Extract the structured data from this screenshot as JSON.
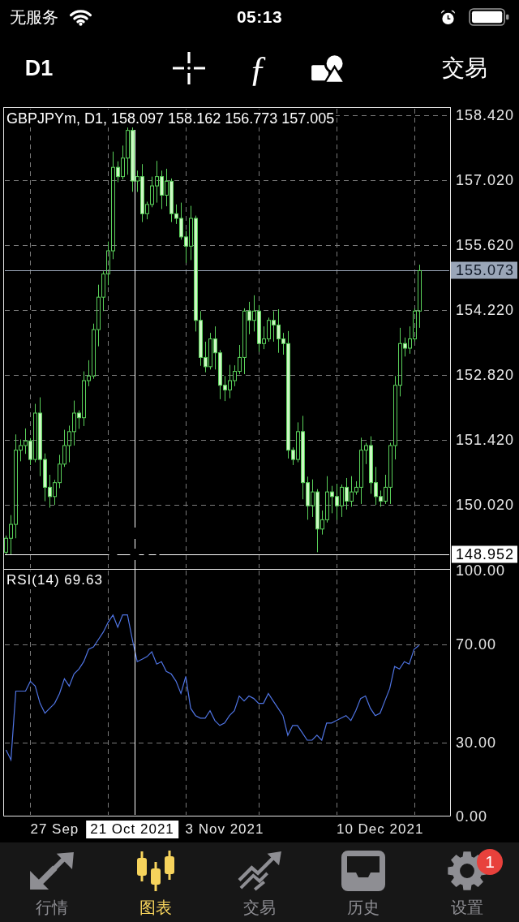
{
  "status_bar": {
    "carrier": "无服务",
    "time": "05:13"
  },
  "toolbar": {
    "timeframe": "D1",
    "indicator_glyph": "ƒ",
    "trade_button": "交易"
  },
  "price_chart": {
    "chart_data": {
      "type": "candlestick",
      "title": "GBPJPYm, D1, 158.097 158.162 156.773 157.005",
      "categories": [
        null,
        null,
        null,
        null,
        null,
        null,
        null,
        null,
        null,
        null,
        null,
        null,
        null,
        null,
        null,
        null,
        null,
        null,
        null,
        null,
        null,
        null,
        null,
        null,
        null,
        null,
        null,
        null,
        null,
        null,
        null,
        null,
        null,
        null,
        null,
        null,
        null,
        null,
        null,
        null,
        null,
        null,
        null,
        null,
        null,
        null,
        null,
        null,
        null,
        null,
        null,
        null,
        null,
        null,
        null,
        null,
        null,
        null,
        null,
        null,
        null,
        null,
        null,
        null,
        null,
        null,
        null,
        null,
        null,
        null,
        null,
        null,
        null,
        null,
        null,
        null,
        null,
        null,
        null,
        null,
        null,
        null,
        null,
        null,
        null,
        null,
        null,
        null,
        null,
        null,
        null,
        null
      ],
      "ohlc": [
        [
          149.0,
          149.36,
          148.94,
          149.3
        ],
        [
          149.3,
          149.8,
          148.94,
          149.6
        ],
        [
          149.6,
          151.54,
          149.3,
          151.2
        ],
        [
          151.2,
          151.43,
          150.96,
          151.3
        ],
        [
          151.3,
          151.67,
          151.12,
          151.4
        ],
        [
          151.4,
          151.46,
          150.88,
          151.0
        ],
        [
          151.0,
          152.2,
          150.94,
          152.0
        ],
        [
          152.0,
          152.34,
          150.64,
          151.0
        ],
        [
          151.0,
          151.13,
          150.1,
          150.4
        ],
        [
          150.4,
          150.67,
          149.96,
          150.2
        ],
        [
          150.2,
          150.56,
          150.02,
          150.5
        ],
        [
          150.5,
          151.1,
          150.38,
          150.9
        ],
        [
          150.9,
          151.64,
          150.84,
          151.3
        ],
        [
          151.3,
          151.73,
          150.94,
          151.6
        ],
        [
          151.6,
          152.27,
          151.3,
          152.0
        ],
        [
          152.0,
          152.06,
          151.66,
          151.9
        ],
        [
          151.9,
          152.9,
          151.72,
          152.7
        ],
        [
          152.7,
          153.14,
          152.58,
          152.8
        ],
        [
          152.8,
          153.93,
          152.74,
          153.8
        ],
        [
          153.8,
          154.77,
          153.44,
          154.5
        ],
        [
          154.5,
          155.06,
          154.2,
          155.0
        ],
        [
          155.0,
          155.7,
          154.76,
          155.5
        ],
        [
          155.5,
          157.64,
          155.32,
          157.3
        ],
        [
          157.3,
          157.43,
          156.98,
          157.1
        ],
        [
          157.1,
          157.77,
          157.04,
          157.5
        ],
        [
          157.5,
          158.16,
          157.14,
          158.097
        ],
        [
          158.097,
          158.162,
          156.773,
          157.005
        ],
        [
          157.005,
          157.23,
          156.77,
          157.1
        ],
        [
          157.1,
          157.37,
          156.12,
          156.3
        ],
        [
          156.3,
          156.56,
          156.18,
          156.5
        ],
        [
          156.5,
          157.1,
          156.44,
          156.9
        ],
        [
          156.9,
          157.44,
          156.54,
          157.1
        ],
        [
          157.1,
          157.23,
          156.4,
          156.7
        ],
        [
          156.7,
          157.27,
          156.46,
          157.0
        ],
        [
          157.0,
          157.06,
          156.12,
          156.3
        ],
        [
          156.3,
          156.5,
          156.08,
          156.2
        ],
        [
          156.2,
          156.54,
          155.74,
          155.8
        ],
        [
          155.8,
          155.93,
          155.24,
          155.6
        ],
        [
          155.6,
          156.47,
          155.3,
          156.2
        ],
        [
          156.2,
          156.26,
          153.76,
          154.0
        ],
        [
          154.0,
          154.2,
          153.02,
          153.2
        ],
        [
          153.2,
          153.54,
          152.88,
          153.0
        ],
        [
          153.0,
          153.73,
          152.94,
          153.6
        ],
        [
          153.6,
          153.87,
          152.94,
          153.3
        ],
        [
          153.3,
          153.36,
          152.3,
          152.6
        ],
        [
          152.6,
          152.8,
          152.26,
          152.5
        ],
        [
          152.5,
          153.04,
          152.32,
          152.7
        ],
        [
          152.7,
          153.03,
          152.58,
          152.9
        ],
        [
          152.9,
          153.47,
          152.84,
          153.2
        ],
        [
          153.2,
          154.26,
          152.84,
          154.2
        ],
        [
          154.2,
          154.4,
          153.7,
          154.0
        ],
        [
          154.0,
          154.54,
          153.76,
          154.2
        ],
        [
          154.2,
          154.33,
          153.32,
          153.5
        ],
        [
          153.5,
          153.87,
          153.38,
          153.6
        ],
        [
          153.6,
          154.06,
          153.54,
          154.0
        ],
        [
          154.0,
          154.2,
          153.54,
          153.9
        ],
        [
          153.9,
          154.24,
          153.3,
          153.6
        ],
        [
          153.6,
          153.73,
          153.26,
          153.5
        ],
        [
          153.5,
          153.77,
          151.02,
          151.2
        ],
        [
          151.2,
          151.26,
          150.88,
          151.0
        ],
        [
          151.0,
          151.8,
          150.94,
          151.6
        ],
        [
          151.6,
          151.94,
          150.14,
          150.5
        ],
        [
          150.5,
          150.63,
          149.7,
          150.0
        ],
        [
          150.0,
          150.57,
          149.76,
          150.3
        ],
        [
          150.3,
          150.36,
          149.0,
          149.5
        ],
        [
          149.5,
          149.9,
          149.38,
          149.7
        ],
        [
          149.7,
          150.64,
          149.64,
          150.3
        ],
        [
          150.3,
          150.43,
          149.84,
          150.2
        ],
        [
          150.2,
          150.47,
          149.7,
          150.0
        ],
        [
          150.0,
          150.46,
          149.76,
          150.4
        ],
        [
          150.4,
          150.6,
          149.92,
          150.1
        ],
        [
          150.1,
          150.64,
          149.98,
          150.3
        ],
        [
          150.3,
          150.53,
          150.24,
          150.4
        ],
        [
          150.4,
          151.47,
          150.04,
          151.2
        ],
        [
          151.2,
          151.36,
          150.9,
          151.3
        ],
        [
          151.3,
          151.5,
          150.26,
          150.5
        ],
        [
          150.5,
          150.84,
          150.02,
          150.2
        ],
        [
          150.2,
          150.33,
          149.98,
          150.1
        ],
        [
          150.1,
          150.67,
          150.04,
          150.4
        ],
        [
          150.4,
          151.36,
          150.04,
          151.3
        ],
        [
          151.3,
          152.8,
          151.0,
          152.6
        ],
        [
          152.6,
          153.84,
          152.36,
          153.5
        ],
        [
          153.5,
          153.63,
          153.22,
          153.4
        ],
        [
          153.4,
          153.87,
          153.28,
          153.6
        ],
        [
          153.6,
          154.26,
          153.54,
          154.2
        ],
        [
          154.2,
          155.2,
          153.84,
          155.073
        ],
        null,
        null,
        null,
        null,
        null,
        null
      ],
      "ylim": [
        148.63,
        158.59
      ],
      "yticks": [
        {
          "value": 158.42,
          "label": "158.420"
        },
        {
          "value": 157.02,
          "label": "157.020"
        },
        {
          "value": 155.62,
          "label": "155.620"
        },
        {
          "value": 154.22,
          "label": "154.220"
        },
        {
          "value": 152.82,
          "label": "152.820"
        },
        {
          "value": 151.42,
          "label": "151.420"
        },
        {
          "value": 150.02,
          "label": "150.020"
        }
      ],
      "grid": true,
      "ref_lines": [
        {
          "axis": "y",
          "value": 155.073,
          "label": "155.073",
          "color": "#9aa6b8"
        }
      ]
    }
  },
  "crosshair": {
    "price_label": "148.952",
    "date_label": "21 Oct 2021"
  },
  "rsi_chart": {
    "chart_data": {
      "type": "line",
      "title": "RSI(14) 69.63",
      "categories": [
        null,
        null,
        null,
        null,
        null,
        null,
        null,
        null,
        null,
        null,
        "27 Sep",
        null,
        null,
        null,
        null,
        null,
        null,
        null,
        null,
        null,
        null,
        null,
        null,
        null,
        null,
        null,
        null,
        null,
        null,
        null,
        null,
        null,
        null,
        null,
        null,
        null,
        null,
        null,
        null,
        null,
        null,
        null,
        null,
        null,
        null,
        "3 Nov 2021",
        null,
        null,
        null,
        null,
        null,
        null,
        null,
        null,
        null,
        null,
        null,
        null,
        null,
        null,
        null,
        null,
        null,
        null,
        null,
        null,
        null,
        null,
        null,
        null,
        null,
        null,
        null,
        null,
        null,
        null,
        null,
        "10 Dec 2021",
        null,
        null,
        null,
        null,
        null,
        null,
        null,
        null,
        null,
        null,
        null,
        null,
        null,
        null
      ],
      "ylim": [
        0,
        100
      ],
      "yticks": [
        {
          "value": 100,
          "label": "100.00"
        },
        {
          "value": 70,
          "label": "70.00"
        },
        {
          "value": 30,
          "label": "30.00"
        },
        {
          "value": 0,
          "label": "0.00"
        }
      ],
      "grid": true,
      "series": [
        {
          "color": "#4f74e3",
          "values": [
            27,
            23,
            51,
            51,
            51,
            55,
            53,
            46,
            42,
            44,
            46,
            50,
            56,
            53,
            58,
            60,
            63,
            68,
            69,
            72,
            75,
            79,
            82,
            77,
            82,
            82,
            72,
            63,
            64,
            65,
            67,
            62,
            63,
            59,
            58,
            55,
            50,
            57,
            44,
            41,
            40,
            40,
            43,
            39,
            37,
            38,
            41,
            43,
            49,
            47,
            49,
            48,
            46,
            46,
            50,
            47,
            44,
            41,
            33,
            37,
            37,
            34,
            31,
            31,
            33,
            31,
            38,
            38,
            39,
            40,
            41,
            39,
            43,
            48,
            49,
            44,
            41,
            42,
            47,
            52,
            61,
            60,
            63,
            62,
            68,
            69.6,
            null,
            null,
            null,
            null,
            null,
            null
          ]
        }
      ]
    }
  },
  "tab_bar": [
    {
      "label": "行情",
      "selected": false
    },
    {
      "label": "图表",
      "selected": true
    },
    {
      "label": "交易",
      "selected": false
    },
    {
      "label": "历史",
      "selected": false
    },
    {
      "label": "设置",
      "selected": false,
      "badge": "1"
    }
  ]
}
